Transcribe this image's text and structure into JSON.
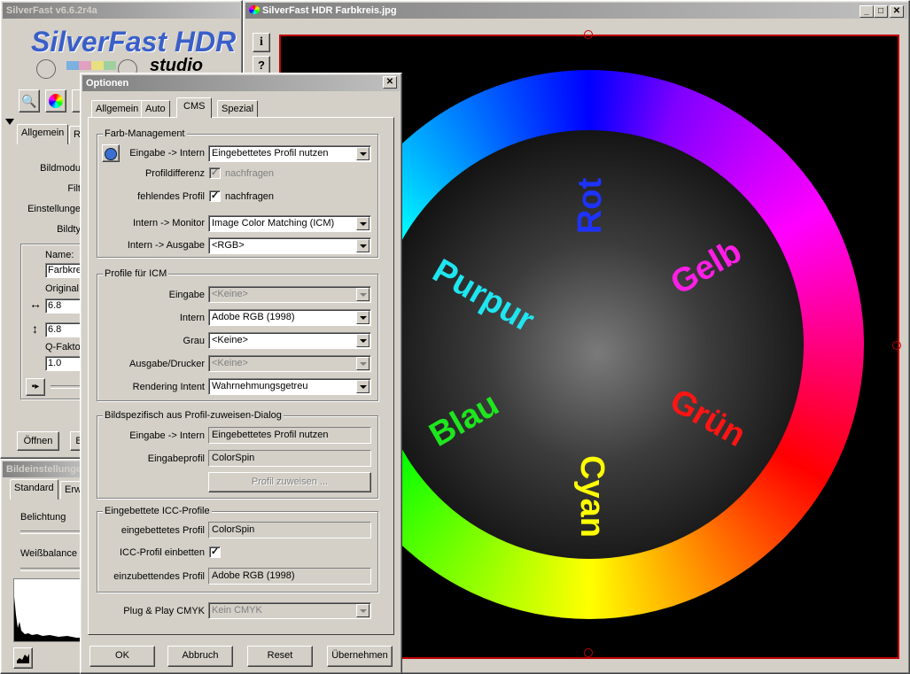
{
  "main_window": {
    "title": "SilverFast v6.6.2r4a",
    "logo_text": "SilverFast HDR",
    "logo_sub": "studio",
    "tabs": [
      "Allgemein",
      "R"
    ],
    "labels": [
      "Bildmodu",
      "Filt",
      "Einstellunge",
      "Bildty"
    ],
    "name_label": "Name:",
    "name_value": "Farbkreis",
    "original_label": "Original",
    "width_value": "6.8",
    "height_value": "6.8",
    "q_label": "Q-Fakto",
    "q_value": "1.0",
    "open_button": "Öffnen",
    "b_button": "B"
  },
  "image_settings": {
    "title": "Bildeinstellunge",
    "tabs": [
      "Standard",
      "Erw"
    ],
    "labels": [
      "Belichtung",
      "Weißbalance"
    ]
  },
  "preview_window": {
    "title": "SilverFast HDR Farbkreis.jpg",
    "side_buttons": [
      "i",
      "?"
    ],
    "color_words": [
      {
        "text": "Rot",
        "color": "#1e32ff"
      },
      {
        "text": "Gelb",
        "color": "#ff1ee6"
      },
      {
        "text": "Grün",
        "color": "#ff1414"
      },
      {
        "text": "Cyan",
        "color": "#ffff00"
      },
      {
        "text": "Blau",
        "color": "#1ee61e"
      },
      {
        "text": "Purpur",
        "color": "#1ee6f0"
      }
    ]
  },
  "options_dialog": {
    "title": "Optionen",
    "tabs": {
      "general": "Allgemein",
      "auto": "Auto",
      "cms": "CMS",
      "special": "Spezial"
    },
    "color_management": {
      "title": "Farb-Management",
      "input_internal_label": "Eingabe -> Intern",
      "input_internal_value": "Eingebettetes Profil nutzen",
      "profile_diff_label": "Profildifferenz",
      "profile_diff_check_label": "nachfragen",
      "missing_profile_label": "fehlendes Profil",
      "missing_profile_check_label": "nachfragen",
      "internal_monitor_label": "Intern -> Monitor",
      "internal_monitor_value": "Image Color Matching (ICM)",
      "internal_output_label": "Intern -> Ausgabe",
      "internal_output_value": "<RGB>"
    },
    "icm_profiles": {
      "title": "Profile für ICM",
      "input_label": "Eingabe",
      "input_value": "<Keine>",
      "internal_label": "Intern",
      "internal_value": "Adobe RGB (1998)",
      "gray_label": "Grau",
      "gray_value": "<Keine>",
      "printer_label": "Ausgabe/Drucker",
      "printer_value": "<Keine>",
      "rendering_label": "Rendering Intent",
      "rendering_value": "Wahrnehmungsgetreu"
    },
    "assign_dialog": {
      "title": "Bildspezifisch aus Profil-zuweisen-Dialog",
      "input_internal_label": "Eingabe -> Intern",
      "input_internal_value": "Eingebettetes Profil nutzen",
      "input_profile_label": "Eingabeprofil",
      "input_profile_value": "ColorSpin",
      "assign_button": "Profil zuweisen ..."
    },
    "embedded_icc": {
      "title": "Eingebettete ICC-Profile",
      "embedded_label": "eingebettetes Profil",
      "embedded_value": "ColorSpin",
      "embed_label": "ICC-Profil einbetten",
      "to_embed_label": "einzubettendes Profil",
      "to_embed_value": "Adobe RGB (1998)"
    },
    "plug_play_label": "Plug & Play CMYK",
    "plug_play_value": "Kein CMYK",
    "buttons": {
      "ok": "OK",
      "cancel": "Abbruch",
      "reset": "Reset",
      "apply": "Übernehmen"
    }
  }
}
